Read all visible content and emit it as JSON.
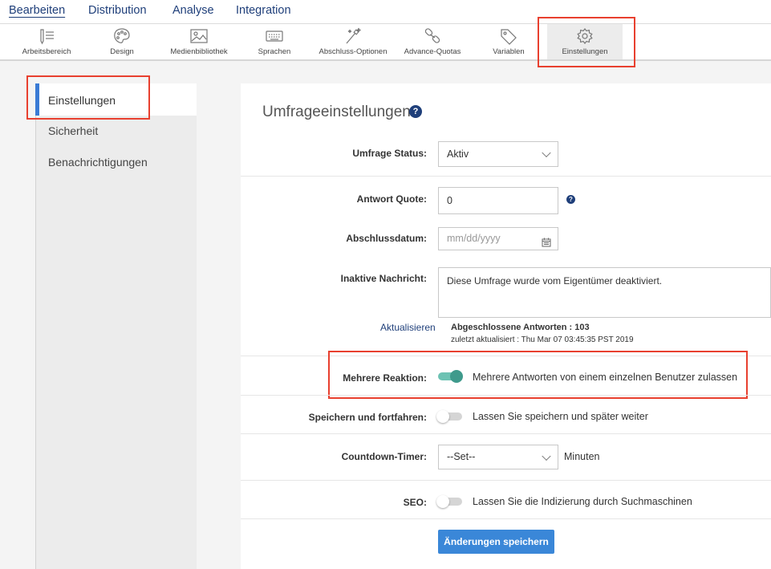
{
  "nav": {
    "tabs": [
      "Bearbeiten",
      "Distribution",
      "Analyse",
      "Integration"
    ]
  },
  "toolbar": {
    "items": [
      {
        "label": "Arbeitsbereich",
        "icon": "workspace-icon"
      },
      {
        "label": "Design",
        "icon": "palette-icon"
      },
      {
        "label": "Medienbibliothek",
        "icon": "image-icon"
      },
      {
        "label": "Sprachen",
        "icon": "keyboard-icon"
      },
      {
        "label": "Abschluss-Optionen",
        "icon": "magic-wand-icon"
      },
      {
        "label": "Advance-Quotas",
        "icon": "chain-link-icon"
      },
      {
        "label": "Variablen",
        "icon": "tag-icon"
      },
      {
        "label": "Einstellungen",
        "icon": "gear-icon"
      }
    ]
  },
  "sidebar": {
    "items": [
      "Einstellungen",
      "Sicherheit",
      "Benachrichtigungen"
    ]
  },
  "main": {
    "title": "Umfrageeinstellungen",
    "help": "?",
    "status": {
      "label": "Umfrage Status:",
      "value": "Aktiv"
    },
    "quota": {
      "label": "Antwort Quote:",
      "value": "0"
    },
    "close_date": {
      "label": "Abschlussdatum:",
      "placeholder": "mm/dd/yyyy"
    },
    "inactive_msg": {
      "label": "Inaktive Nachricht:",
      "value": "Diese Umfrage wurde vom Eigentümer deaktiviert."
    },
    "refresh": {
      "link": "Aktualisieren",
      "completed": "Abgeschlossene Antworten : 103",
      "updated": "zuletzt aktualisiert : Thu Mar 07 03:45:35 PST 2019"
    },
    "multi": {
      "label": "Mehrere Reaktion:",
      "text": "Mehrere Antworten von einem einzelnen Benutzer zulassen"
    },
    "save_continue": {
      "label": "Speichern und fortfahren:",
      "text": "Lassen Sie speichern und später weiter"
    },
    "countdown": {
      "label": "Countdown-Timer:",
      "value": "--Set--",
      "unit": "Minuten"
    },
    "seo": {
      "label": "SEO:",
      "text": "Lassen Sie die Indizierung durch Suchmaschinen"
    },
    "save_button": "Änderungen speichern"
  },
  "colors": {
    "nav_text": "#1f3f7a",
    "accent_blue": "#3a87d8",
    "toggle_on": "#3f9a8c",
    "highlight_red": "#e8402f"
  }
}
